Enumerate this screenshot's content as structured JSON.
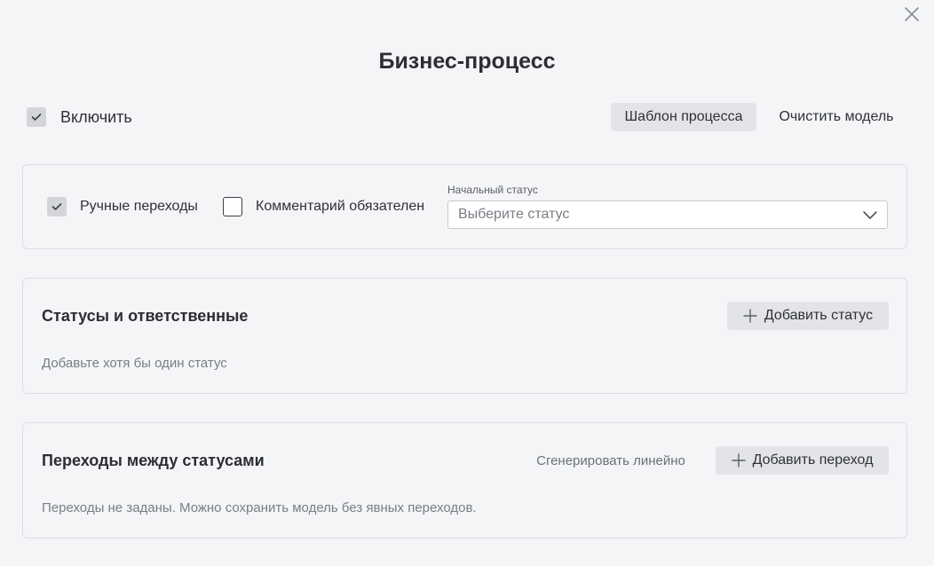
{
  "dialog": {
    "title": "Бизнес-процесс",
    "close_icon": "close-icon"
  },
  "header": {
    "enable": {
      "label": "Включить",
      "checked": true
    },
    "template_button": "Шаблон процесса",
    "clear_button": "Очистить модель"
  },
  "settings": {
    "manual_transitions": {
      "label": "Ручные переходы",
      "checked": true
    },
    "comment_required": {
      "label": "Комментарий обязателен",
      "checked": false
    },
    "initial_status": {
      "label": "Начальный статус",
      "placeholder": "Выберите статус"
    }
  },
  "statuses": {
    "title": "Статусы и ответственные",
    "add_button": "Добавить статус",
    "empty_text": "Добавьте хотя бы один статус"
  },
  "transitions": {
    "title": "Переходы между статусами",
    "generate_link": "Сгенерировать линейно",
    "add_button": "Добавить переход",
    "empty_text": "Переходы не заданы. Можно сохранить модель без явных переходов."
  },
  "colors": {
    "background": "#f4f5f7",
    "button_gray": "#e2e4e8",
    "checkbox_checked": "#d3d5da",
    "text_muted": "#7a7d85"
  }
}
